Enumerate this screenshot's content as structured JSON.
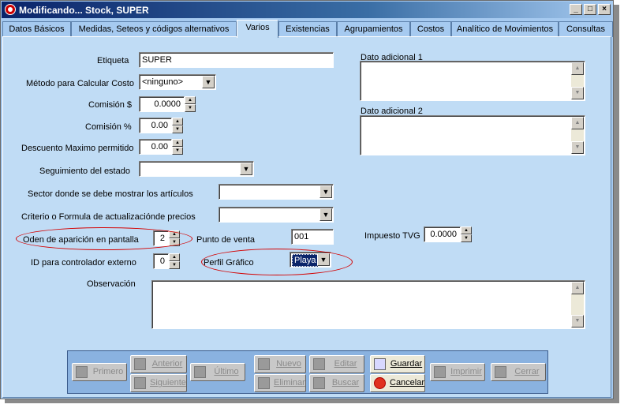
{
  "window": {
    "title": "Modificando... Stock, SUPER"
  },
  "tabs": [
    {
      "label": "Datos Básicos"
    },
    {
      "label": "Medidas, Seteos y códigos alternativos"
    },
    {
      "label": "Varios"
    },
    {
      "label": "Existencias"
    },
    {
      "label": "Agrupamientos"
    },
    {
      "label": "Costos"
    },
    {
      "label": "Analítico de Movimientos"
    },
    {
      "label": "Consultas"
    }
  ],
  "form": {
    "etiqueta": {
      "label": "Etiqueta",
      "value": "SUPER"
    },
    "metodo": {
      "label": "Método para Calcular Costo",
      "value": "<ninguno>"
    },
    "comision_pesos": {
      "label": "Comisión $",
      "value": "0.0000"
    },
    "comision_pct": {
      "label": "Comisión %",
      "value": "0.00"
    },
    "descuento": {
      "label": "Descuento Maximo permitido",
      "value": "0.00"
    },
    "seguimiento": {
      "label": "Seguimiento del estado",
      "value": ""
    },
    "sector": {
      "label": "Sector donde se debe mostrar los artículos",
      "value": ""
    },
    "criterio": {
      "label": "Criterio o Formula de actualizacióndе precios",
      "value": ""
    },
    "orden": {
      "label": "Oden de aparición en pantalla",
      "value": "2"
    },
    "id_controlador": {
      "label": "ID para controlador externo",
      "value": "0"
    },
    "punto_venta": {
      "label": "Punto de venta",
      "value": "001"
    },
    "perfil_grafico": {
      "label": "Perfil Gráfico",
      "value": "Playa"
    },
    "impuesto_tvg": {
      "label": "Impuesto TVG",
      "value": "0.0000"
    },
    "observacion": {
      "label": "Observación",
      "value": ""
    },
    "dato_adicional_1": {
      "label": "Dato adicional 1",
      "value": ""
    },
    "dato_adicional_2": {
      "label": "Dato adicional 2",
      "value": ""
    }
  },
  "toolbar": {
    "primero": "Primero",
    "anterior": "Anterior",
    "siguiente": "Siguiente",
    "ultimo": "Último",
    "nuevo": "Nuevo",
    "eliminar": "Eliminar",
    "editar": "Editar",
    "buscar": "Buscar",
    "guardar": "Guardar",
    "cancelar": "Cancelar",
    "imprimir": "Imprimir",
    "cerrar": "Cerrar"
  },
  "colors": {
    "annotation": "#d40000",
    "panel": "#c0dcf5",
    "toolbar": "#8ab2e0"
  }
}
